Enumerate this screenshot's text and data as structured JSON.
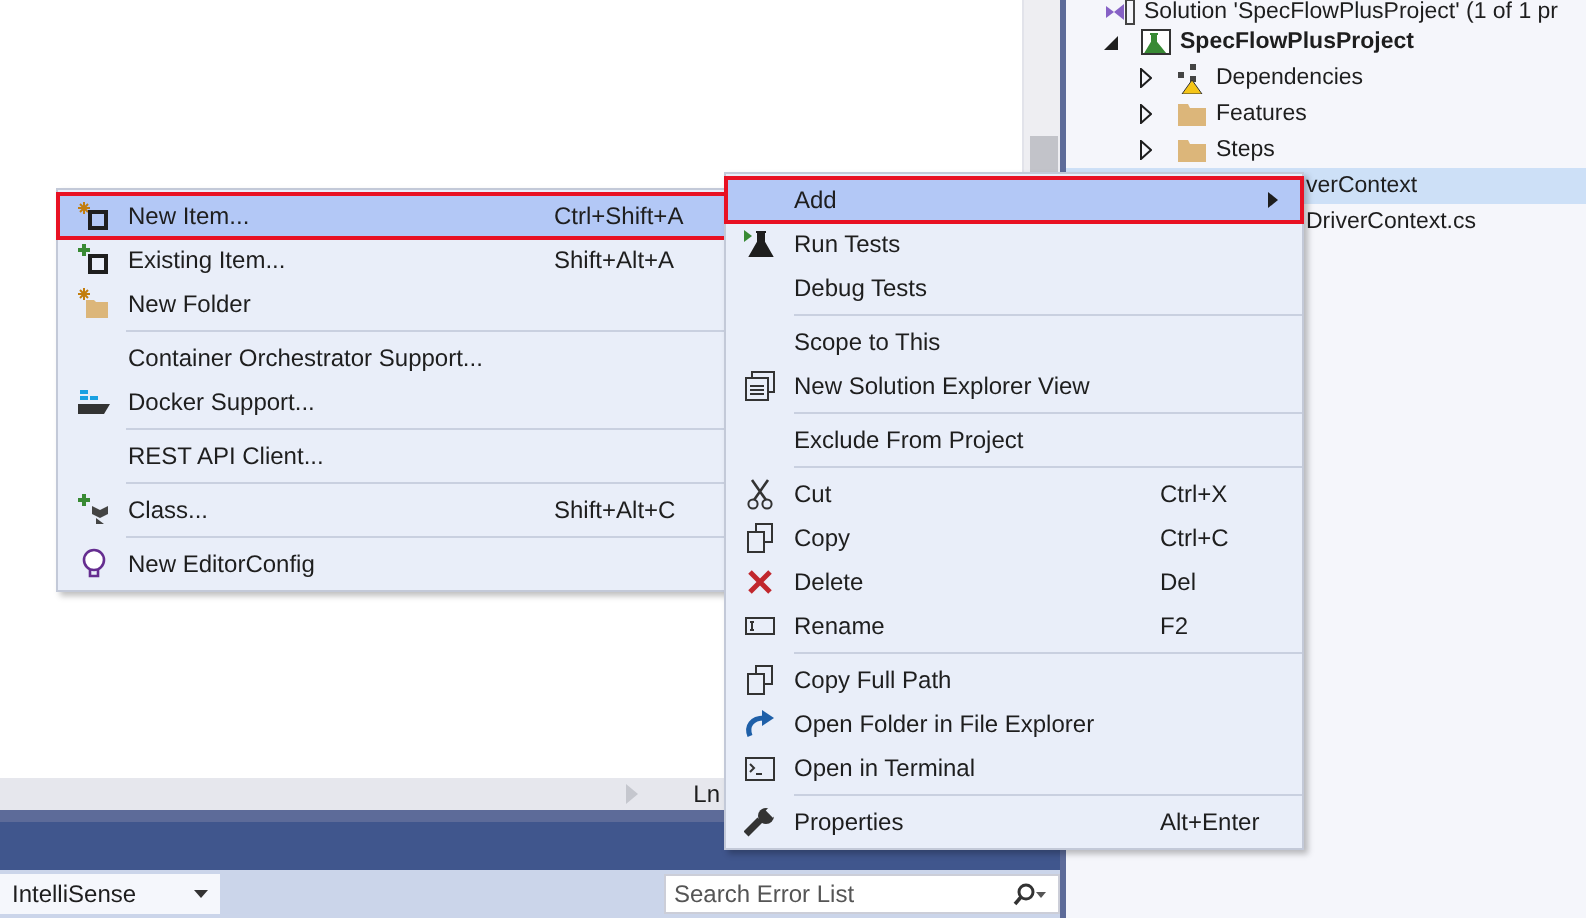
{
  "solution_explorer": {
    "items": [
      {
        "label": "Solution 'SpecFlowPlusProject' (1 of 1 pr",
        "selected": false,
        "children": [
          {
            "label": "SpecFlowPlusProject",
            "expanded": true,
            "selected": false,
            "children": [
              {
                "label": "Dependencies",
                "expanded": false,
                "selected": false
              },
              {
                "label": "Features",
                "expanded": false,
                "selected": false
              },
              {
                "label": "Steps",
                "expanded": false,
                "selected": false
              },
              {
                "label": "verContext",
                "selected": true,
                "children": [
                  {
                    "label": "DriverContext.cs",
                    "selected": false
                  }
                ]
              }
            ]
          }
        ]
      }
    ]
  },
  "status_bar": {
    "position": "Ln"
  },
  "error_list": {
    "filter": "IntelliSense",
    "search": {
      "placeholder": "Search Error List"
    }
  },
  "context_menu": {
    "items": [
      {
        "kind": "item",
        "label": "Add",
        "selected": true,
        "submenu": true
      },
      {
        "kind": "item",
        "label": "Run Tests",
        "selected": false
      },
      {
        "kind": "item",
        "label": "Debug Tests",
        "selected": false
      },
      {
        "kind": "separator"
      },
      {
        "kind": "item",
        "label": "Scope to This",
        "selected": false
      },
      {
        "kind": "item",
        "label": "New Solution Explorer View",
        "selected": false
      },
      {
        "kind": "separator"
      },
      {
        "kind": "item",
        "label": "Exclude From Project",
        "selected": false
      },
      {
        "kind": "separator"
      },
      {
        "kind": "item",
        "label": "Cut",
        "shortcut": "Ctrl+X",
        "selected": false
      },
      {
        "kind": "item",
        "label": "Copy",
        "shortcut": "Ctrl+C",
        "selected": false
      },
      {
        "kind": "item",
        "label": "Delete",
        "shortcut": "Del",
        "selected": false
      },
      {
        "kind": "item",
        "label": "Rename",
        "shortcut": "F2",
        "selected": false
      },
      {
        "kind": "separator"
      },
      {
        "kind": "item",
        "label": "Copy Full Path",
        "selected": false
      },
      {
        "kind": "item",
        "label": "Open Folder in File Explorer",
        "selected": false
      },
      {
        "kind": "item",
        "label": "Open in Terminal",
        "selected": false
      },
      {
        "kind": "separator"
      },
      {
        "kind": "item",
        "label": "Properties",
        "shortcut": "Alt+Enter",
        "selected": false
      }
    ]
  },
  "add_submenu": {
    "items": [
      {
        "kind": "item",
        "label": "New Item...",
        "shortcut": "Ctrl+Shift+A",
        "selected": true
      },
      {
        "kind": "item",
        "label": "Existing Item...",
        "shortcut": "Shift+Alt+A",
        "selected": false
      },
      {
        "kind": "item",
        "label": "New Folder",
        "selected": false
      },
      {
        "kind": "separator"
      },
      {
        "kind": "item",
        "label": "Container Orchestrator Support...",
        "selected": false
      },
      {
        "kind": "item",
        "label": "Docker Support...",
        "selected": false
      },
      {
        "kind": "separator"
      },
      {
        "kind": "item",
        "label": "REST API Client...",
        "selected": false
      },
      {
        "kind": "separator"
      },
      {
        "kind": "item",
        "label": "Class...",
        "shortcut": "Shift+Alt+C",
        "selected": false
      },
      {
        "kind": "separator"
      },
      {
        "kind": "item",
        "label": "New EditorConfig",
        "selected": false
      }
    ]
  }
}
